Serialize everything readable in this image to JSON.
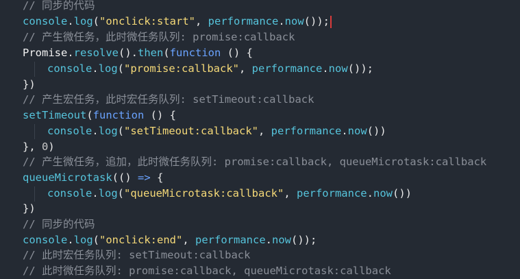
{
  "code": {
    "l1": "// 同步的代码",
    "l2_obj": "console",
    "l2_fn": "log",
    "l2_str": "\"onclick:start\"",
    "l2_obj2": "performance",
    "l2_fn2": "now",
    "l3": "// 产生微任务，此时微任务队列: promise:callback",
    "l4_obj": "Promise",
    "l4_fn1": "resolve",
    "l4_fn2": "then",
    "l4_kw": "function",
    "l5_obj": "console",
    "l5_fn": "log",
    "l5_str": "\"promise:callback\"",
    "l5_obj2": "performance",
    "l5_fn2": "now",
    "l6": "})",
    "l7": "// 产生宏任务，此时宏任务队列: setTimeout:callback",
    "l8_fn": "setTimeout",
    "l8_kw": "function",
    "l9_obj": "console",
    "l9_fn": "log",
    "l9_str": "\"setTimeout:callback\"",
    "l9_obj2": "performance",
    "l9_fn2": "now",
    "l10_num": "0",
    "l11": "// 产生微任务，追加，此时微任务队列: promise:callback, queueMicrotask:callback",
    "l12_fn": "queueMicrotask",
    "l13_obj": "console",
    "l13_fn": "log",
    "l13_str": "\"queueMicrotask:callback\"",
    "l13_obj2": "performance",
    "l13_fn2": "now",
    "l14": "})",
    "l15": "// 同步的代码",
    "l16_obj": "console",
    "l16_fn": "log",
    "l16_str": "\"onclick:end\"",
    "l16_obj2": "performance",
    "l16_fn2": "now",
    "l17": "// 此时宏任务队列: setTimeout:callback",
    "l18": "// 此时微任务队列: promise:callback, queueMicrotask:callback"
  },
  "colors": {
    "background": "#242a33",
    "comment": "#8a8f98",
    "string": "#f5d978",
    "keyword": "#6aa3ff",
    "identifier": "#56c4dc",
    "cursor": "#d93b3b"
  }
}
